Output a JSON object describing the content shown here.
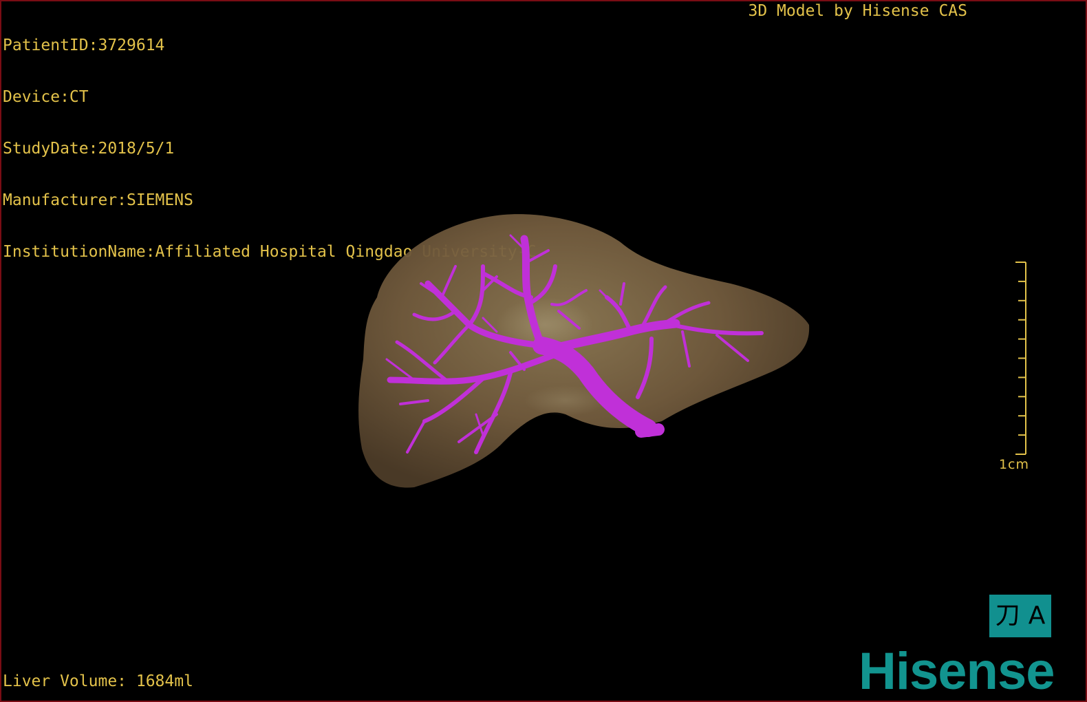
{
  "patient": {
    "patient_id": "PatientID:3729614",
    "device": "Device:CT",
    "study_date": "StudyDate:2018/5/1",
    "manufacturer": "Manufacturer:SIEMENS",
    "institution": "InstitutionName:Affiliated Hospital Qingdao University-C"
  },
  "model_credit": "3D Model by Hisense CAS",
  "liver_volume": "Liver Volume: 1684ml",
  "scale_bar": {
    "label": "1cm"
  },
  "view_toggle": {
    "left_glyph": "刀",
    "right_glyph": "A"
  },
  "brand": {
    "logo_text": "Hisense"
  },
  "colors": {
    "overlay_text": "#e3c24a",
    "liver": "#7a6444",
    "vessel": "#c030d8",
    "brand": "#12948f",
    "frame": "#7a0c14"
  }
}
